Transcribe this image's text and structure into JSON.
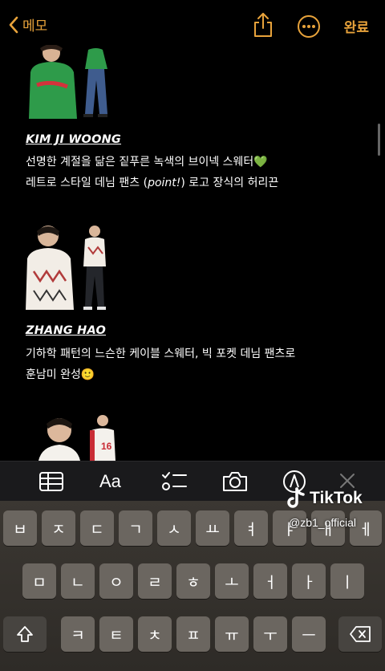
{
  "nav": {
    "back_label": "메모",
    "done_label": "완료"
  },
  "note": {
    "entries": [
      {
        "name": "KIM JI WOONG",
        "lines": [
          "선명한 계절을 닮은 짙푸른 녹색의 브이넥 스웨터💚"
        ],
        "line2_pre": "레트로 스타일 데님 팬츠 (",
        "line2_em": "point!",
        "line2_post": ") 로고 장식의 허리끈"
      },
      {
        "name": "ZHANG HAO",
        "lines": [
          "기하학 패턴의 느슨한 케이블 스웨터, 빅 포켓 데님 팬츠로",
          "훈남미 완성🙂"
        ]
      }
    ],
    "jersey_number": "16"
  },
  "keyboard": {
    "row1": [
      "ㅂ",
      "ㅈ",
      "ㄷ",
      "ㄱ",
      "ㅅ",
      "ㅛ",
      "ㅕ",
      "ㅑ",
      "ㅐ",
      "ㅔ"
    ],
    "row2": [
      "ㅁ",
      "ㄴ",
      "ㅇ",
      "ㄹ",
      "ㅎ",
      "ㅗ",
      "ㅓ",
      "ㅏ",
      "ㅣ"
    ],
    "row3": [
      "ㅋ",
      "ㅌ",
      "ㅊ",
      "ㅍ",
      "ㅠ",
      "ㅜ",
      "ㅡ"
    ]
  },
  "watermark": {
    "brand": "TikTok",
    "handle": "@zb1_official"
  },
  "colors": {
    "accent": "#e8a33b",
    "background": "#000000",
    "keyboard": "#3b3732"
  }
}
